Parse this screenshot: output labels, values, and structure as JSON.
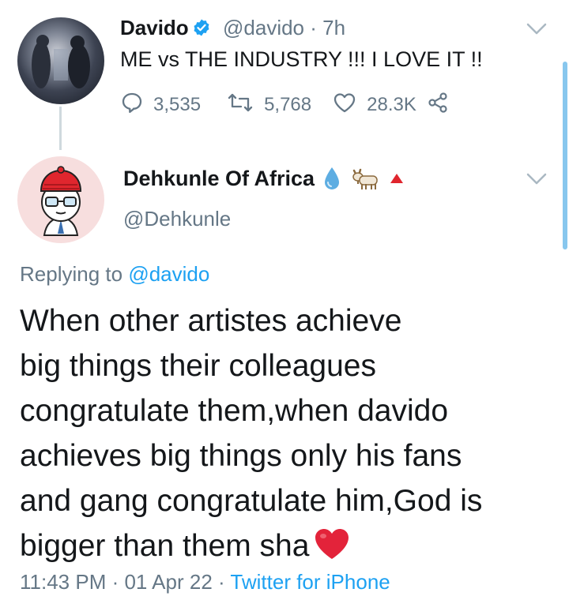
{
  "tweet1": {
    "display_name": "Davido",
    "handle": "@davido",
    "separator": "·",
    "time": "7h",
    "text": "ME vs THE INDUSTRY !!! I LOVE IT !!",
    "replies": "3,535",
    "retweets": "5,768",
    "likes": "28.3K"
  },
  "tweet2": {
    "display_name": "Dehkunle Of Africa",
    "handle": "@Dehkunle",
    "replying_prefix": "Replying to ",
    "replying_to": "@davido",
    "lines": [
      "When other artistes achieve",
      "big things their colleagues",
      "congratulate them,when davido",
      "achieves big things only his fans",
      "and gang congratulate him,God is",
      "bigger than them sha"
    ],
    "timestamp": "11:43 PM · 01 Apr 22 · ",
    "source": "Twitter for iPhone"
  },
  "colors": {
    "accent": "#1da1f2",
    "muted": "#657786",
    "text": "#14171a",
    "heart": "#e0245e"
  },
  "icons": [
    "verified-badge-icon",
    "reply-icon",
    "retweet-icon",
    "like-icon",
    "share-icon",
    "chevron-down-icon",
    "droplet-icon",
    "goat-icon",
    "red-triangle-icon",
    "red-heart-icon"
  ]
}
